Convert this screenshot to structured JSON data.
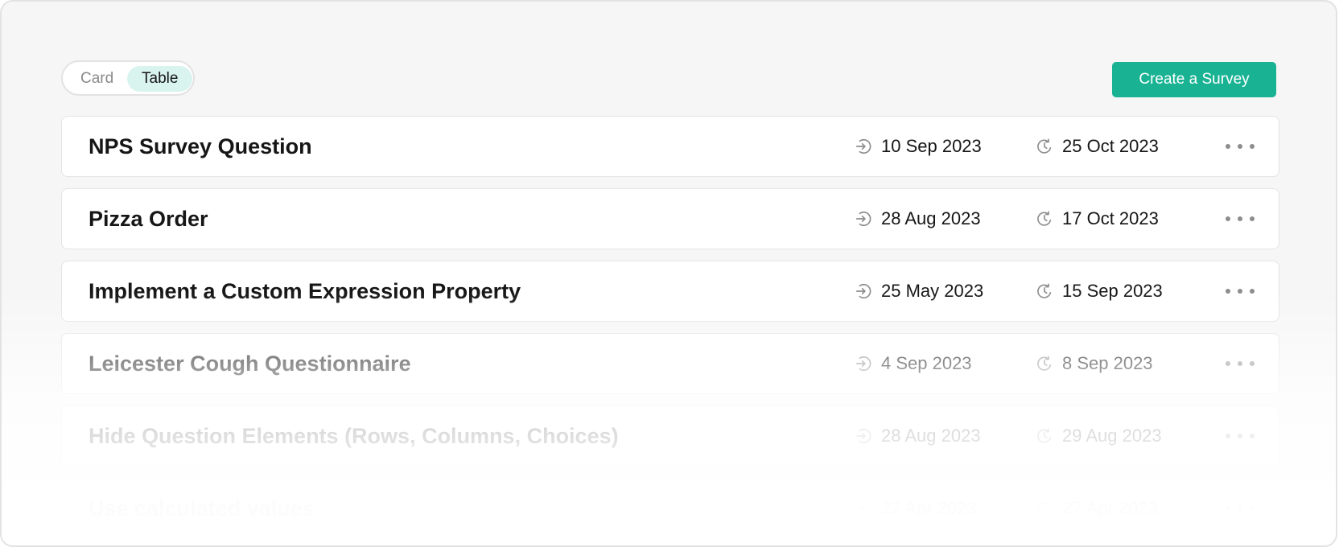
{
  "view_toggle": {
    "card_label": "Card",
    "table_label": "Table",
    "selected": "Table"
  },
  "create_button_label": "Create a Survey",
  "colors": {
    "accent": "#19b394",
    "toggle_selected_bg": "#d9f3ee"
  },
  "icons": {
    "created": "arrow-in-circle-icon",
    "modified": "history-icon",
    "menu": "more-horizontal-icon"
  },
  "surveys": [
    {
      "title": "NPS Survey Question",
      "created": "10 Sep 2023",
      "modified": "25 Oct 2023"
    },
    {
      "title": "Pizza Order",
      "created": "28 Aug 2023",
      "modified": "17 Oct 2023"
    },
    {
      "title": "Implement a Custom Expression Property",
      "created": "25 May 2023",
      "modified": "15 Sep 2023"
    },
    {
      "title": "Leicester Cough Questionnaire",
      "created": "4 Sep 2023",
      "modified": "8 Sep 2023"
    },
    {
      "title": "Hide Question Elements (Rows, Columns, Choices)",
      "created": "28 Aug 2023",
      "modified": "29 Aug 2023"
    },
    {
      "title": "Use calculated values",
      "created": "22 Apr 2023",
      "modified": "27 Apr 2023"
    }
  ]
}
